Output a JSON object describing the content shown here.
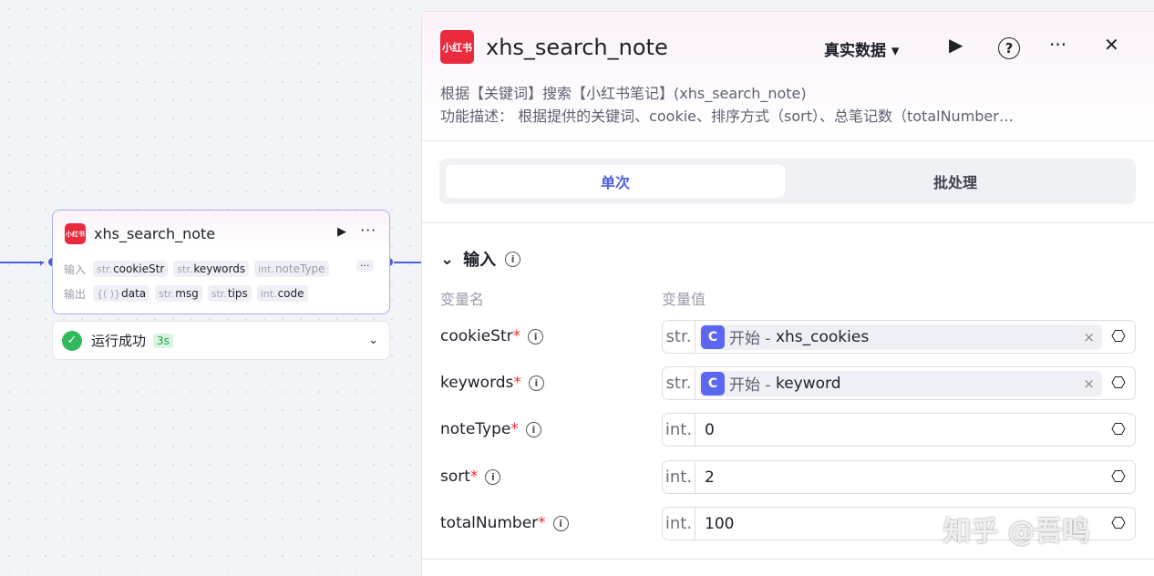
{
  "node": {
    "logo": "小红书",
    "title": "xhs_search_note",
    "input_label": "输入",
    "output_label": "输出",
    "inputs": [
      {
        "type": "str.",
        "name": "cookieStr"
      },
      {
        "type": "str.",
        "name": "keywords"
      },
      {
        "type": "int.",
        "name": "noteType"
      }
    ],
    "outputs": [
      {
        "type": "{( )}",
        "name": "data"
      },
      {
        "type": "str.",
        "name": "msg"
      },
      {
        "type": "str.",
        "name": "tips"
      },
      {
        "type": "int.",
        "name": "code"
      }
    ],
    "more": "···"
  },
  "status": {
    "text": "运行成功",
    "duration": "3s"
  },
  "panel": {
    "logo": "小红书",
    "title": "xhs_search_note",
    "data_mode": "真实数据",
    "desc1": "根据【关键词】搜索【小红书笔记】(xhs_search_note)",
    "desc2": "功能描述： 根据提供的关键词、cookie、排序方式（sort）、总笔记数（totalNumber…",
    "tabs": [
      "单次",
      "批处理"
    ],
    "section": "输入",
    "col_name": "变量名",
    "col_value": "变量值",
    "rows": [
      {
        "name": "cookieStr",
        "type": "str.",
        "ref_src": "开始 -",
        "ref_var": "xhs_cookies"
      },
      {
        "name": "keywords",
        "type": "str.",
        "ref_src": "开始 -",
        "ref_var": "keyword"
      },
      {
        "name": "noteType",
        "type": "int.",
        "value": "0"
      },
      {
        "name": "sort",
        "type": "int.",
        "value": "2"
      },
      {
        "name": "totalNumber",
        "type": "int.",
        "value": "100"
      }
    ]
  },
  "watermark": "知乎 @吾鸣"
}
